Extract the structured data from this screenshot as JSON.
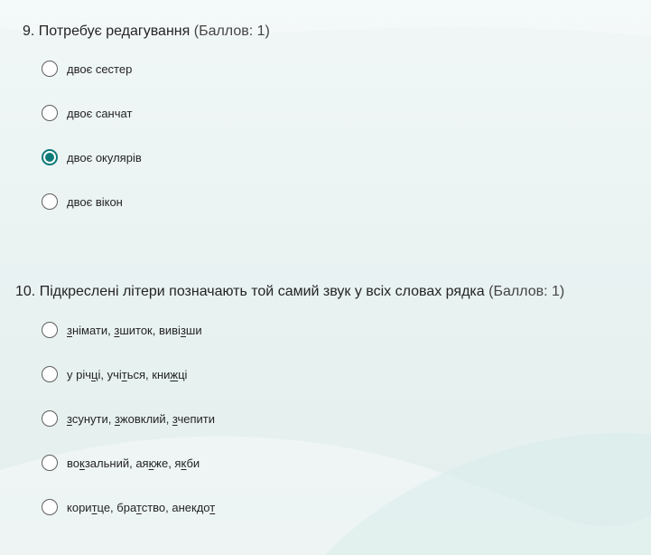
{
  "questions": [
    {
      "title": "9. Потребує редагування",
      "points": "(Баллов: 1)",
      "options": [
        {
          "label": "двоє сестер",
          "checked": false
        },
        {
          "label": "двоє санчат",
          "checked": false
        },
        {
          "label": "двоє окулярів",
          "checked": true
        },
        {
          "label": "двоє вікон",
          "checked": false
        }
      ]
    },
    {
      "title": "10. Підкреслені літери позначають той самий звук у всіх словах рядка",
      "points": "(Баллов: 1)",
      "options": [
        {
          "segments": [
            {
              "t": "з",
              "u": true
            },
            {
              "t": "німати, "
            },
            {
              "t": "з",
              "u": true
            },
            {
              "t": "шиток, виві"
            },
            {
              "t": "з",
              "u": true
            },
            {
              "t": "ши"
            }
          ],
          "checked": false
        },
        {
          "segments": [
            {
              "t": "у річ"
            },
            {
              "t": "ц",
              "u": true
            },
            {
              "t": "і, учі"
            },
            {
              "t": "т",
              "u": true
            },
            {
              "t": "ься, кни"
            },
            {
              "t": "ж",
              "u": true
            },
            {
              "t": "ці"
            }
          ],
          "checked": false
        },
        {
          "segments": [
            {
              "t": "з",
              "u": true
            },
            {
              "t": "сунути, "
            },
            {
              "t": "з",
              "u": true
            },
            {
              "t": "жовклий, "
            },
            {
              "t": "з",
              "u": true
            },
            {
              "t": "чепити"
            }
          ],
          "checked": false
        },
        {
          "segments": [
            {
              "t": "во"
            },
            {
              "t": "к",
              "u": true
            },
            {
              "t": "зальний, ая"
            },
            {
              "t": "к",
              "u": true
            },
            {
              "t": "же, я"
            },
            {
              "t": "к",
              "u": true
            },
            {
              "t": "би"
            }
          ],
          "checked": false
        },
        {
          "segments": [
            {
              "t": "кори"
            },
            {
              "t": "т",
              "u": true
            },
            {
              "t": "це, бра"
            },
            {
              "t": "т",
              "u": true
            },
            {
              "t": "ство, анекдо"
            },
            {
              "t": "т",
              "u": true
            }
          ],
          "checked": false
        }
      ]
    }
  ]
}
